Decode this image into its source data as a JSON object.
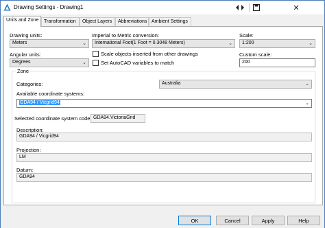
{
  "window": {
    "title": "Drawing Settings - Drawing1"
  },
  "titlebar": {
    "pin_icon": "pin-icon",
    "restore_icon": "restore-icon",
    "close_glyph": "✕"
  },
  "tabs": [
    {
      "label": "Units and Zone"
    },
    {
      "label": "Transformation"
    },
    {
      "label": "Object Layers"
    },
    {
      "label": "Abbreviations"
    },
    {
      "label": "Ambient Settings"
    }
  ],
  "units": {
    "drawing_units_label": "Drawing units:",
    "drawing_units_value": "Meters",
    "angular_units_label": "Angular units:",
    "angular_units_value": "Degrees",
    "imperial_label": "Imperial to Metric conversion:",
    "imperial_value": "International Foot(1 Foot = 0.3048 Meters)",
    "scale_objects_label": "Scale objects inserted from other drawings",
    "set_variables_label": "Set AutoCAD variables to match",
    "scale_label": "Scale:",
    "scale_value": "1:200",
    "custom_scale_label": "Custom scale:",
    "custom_scale_value": "200"
  },
  "zone": {
    "legend": "Zone",
    "categories_label": "Categories:",
    "categories_value": "Australia",
    "available_label": "Available coordinate systems:",
    "available_value": "GDA94 / Vicgrid94",
    "selected_code_label": "Selected coordinate system code:",
    "selected_code_value": "GDA94.VictoriaGrid",
    "description_label": "Description:",
    "description_value": "GDA94 / Vicgrid94",
    "projection_label": "Projection:",
    "projection_value": "LM",
    "datum_label": "Datum:",
    "datum_value": "GDA94"
  },
  "buttons": {
    "ok": "OK",
    "cancel": "Cancel",
    "apply": "Apply",
    "help": "Help"
  },
  "colors": {
    "selection": "#3399ff",
    "accent_border": "#0078d7"
  }
}
